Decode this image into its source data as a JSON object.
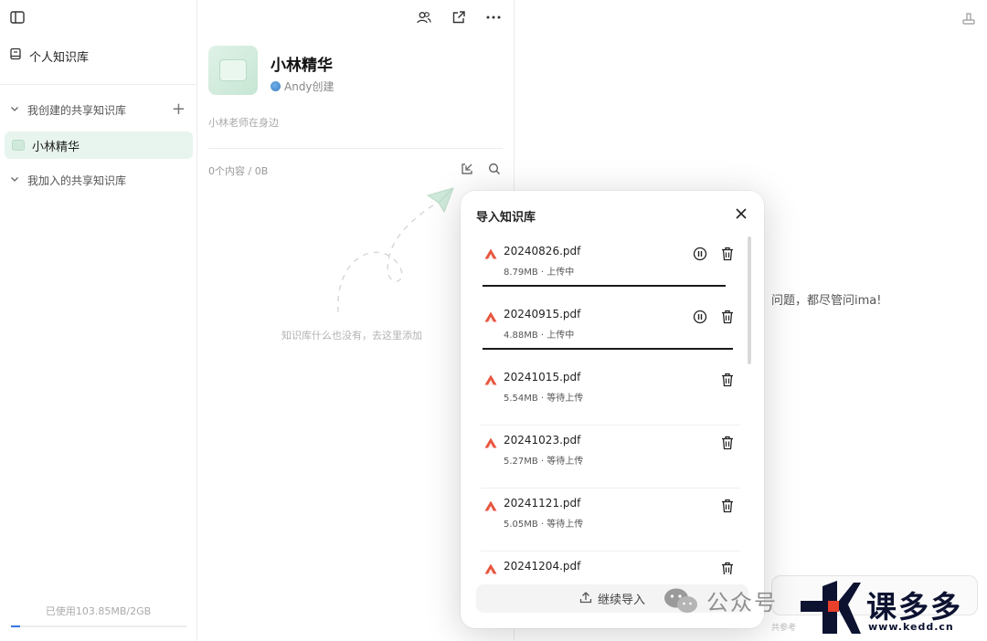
{
  "sidebar": {
    "personal_kb_label": "个人知识库",
    "created_shared_label": "我创建的共享知识库",
    "joined_shared_label": "我加入的共享知识库",
    "active_kb_label": "小林精华",
    "storage_text": "已使用103.85MB/2GB",
    "storage_used_fraction": 0.05
  },
  "knowledge_base": {
    "title": "小林精华",
    "creator": "Andy创建",
    "description": "小林老师在身边",
    "content_count": "0个内容 / 0B",
    "empty_hint": "知识库什么也没有，去这里添加"
  },
  "chat": {
    "hint": "问题，都尽管问ima!",
    "ref_label": "共参考"
  },
  "import_modal": {
    "title": "导入知识库",
    "files": [
      {
        "name": "20240826.pdf",
        "meta": "8.79MB · 上传中",
        "uploading": true,
        "progress": 0.95
      },
      {
        "name": "20240915.pdf",
        "meta": "4.88MB · 上传中",
        "uploading": true,
        "progress": 0.98
      },
      {
        "name": "20241015.pdf",
        "meta": "5.54MB · 等待上传",
        "uploading": false
      },
      {
        "name": "20241023.pdf",
        "meta": "5.27MB · 等待上传",
        "uploading": false
      },
      {
        "name": "20241121.pdf",
        "meta": "5.05MB · 等待上传",
        "uploading": false
      },
      {
        "name": "20241204.pdf",
        "meta": "",
        "uploading": false
      }
    ],
    "continue_label": "继续导入"
  },
  "watermark": {
    "wechat_label": "公众号",
    "logo_text": "课多多",
    "logo_url": "www.kedd.cn"
  },
  "colors": {
    "accent_green": "#e8f5ee",
    "pdf_red": "#e8553e",
    "storage_blue": "#3a74e8"
  },
  "icons": [
    "sidebar-toggle-icon",
    "book-icon",
    "chevron-down-icon",
    "plus-icon",
    "members-icon",
    "share-icon",
    "more-icon",
    "import-icon",
    "search-icon",
    "paper-plane-icon",
    "close-icon",
    "pdf-icon",
    "pause-icon",
    "trash-icon",
    "upload-icon",
    "pin-icon"
  ]
}
